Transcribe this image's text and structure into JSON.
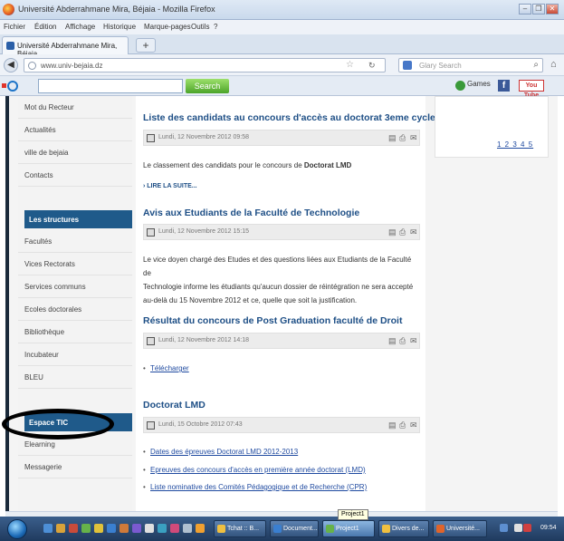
{
  "window": {
    "title": "Université Abderrahmane Mira, Béjaia - Mozilla Firefox",
    "controls": [
      "–",
      "❐",
      "✕"
    ]
  },
  "menu": [
    "Fichier",
    "Édition",
    "Affichage",
    "Historique",
    "Marque-pages",
    "Outils",
    "?"
  ],
  "tab": {
    "label": "Université Abderrahmane Mira, Béjaia",
    "new_tab": "+"
  },
  "nav": {
    "url": "www.univ-bejaia.dz",
    "search_placeholder": "Glary Search"
  },
  "toolbar": {
    "search_label": "Search",
    "games_label": "Games",
    "facebook_label": "f",
    "youtube_label": "You Tube"
  },
  "sidebar": {
    "top_items": [
      "Mot du Recteur",
      "Actualités",
      "ville de bejaia",
      "Contacts"
    ],
    "structures_header": "Les structures",
    "structure_items": [
      "Facultés",
      "Vices Rectorats",
      "Services communs",
      "Ecoles doctorales",
      "Bibliothèque",
      "Incubateur",
      "BLEU"
    ],
    "tic_header": "Espace TIC",
    "tic_items": [
      "Elearning",
      "Messagerie"
    ]
  },
  "articles": [
    {
      "title": "Liste des candidats au concours d'accès au doctorat 3eme cycle",
      "date": "Lundi, 12 Novembre 2012 09:58",
      "body_prefix": "Le classement des candidats pour le concours de ",
      "body_bold": "Doctorat LMD",
      "read_more": "› LIRE LA SUITE..."
    },
    {
      "title": "Avis aux Etudiants de la Faculté de Technologie",
      "date": "Lundi, 12 Novembre 2012 15:15",
      "body_lines": [
        "Le vice doyen chargé des Etudes et des questions liées aux Etudiants de la Faculté de",
        "Technologie informe les étudiants  qu'aucun dossier de réintégration ne sera accepté",
        "au-delà du 15 Novembre 2012 et ce, quelle que soit la justification."
      ]
    },
    {
      "title": "Résultat du concours de Post Graduation faculté de Droit",
      "date": "Lundi, 12 Novembre 2012 14:18",
      "links": [
        "Télécharger"
      ]
    },
    {
      "title": "Doctorat LMD",
      "date": "Lundi, 15 Octobre 2012 07:43",
      "links": [
        "Dates des épreuves Doctorat LMD 2012-2013",
        "Epreuves des concours d'accès en première année doctorat (LMD)",
        "Liste nominative des Comités Pédagogique et de Recherche (CPR)"
      ]
    }
  ],
  "pager": "1 2 3 4 5",
  "taskbar": {
    "tasks": [
      "Tchat :: B...",
      "Document...",
      "Project1",
      "Divers de...",
      "Université..."
    ],
    "tooltip": "Project1",
    "clock": "09:54"
  },
  "colors": {
    "accent": "#1f5a8a",
    "title_link": "#1e4f86",
    "taskbar": "#2a4a74"
  }
}
